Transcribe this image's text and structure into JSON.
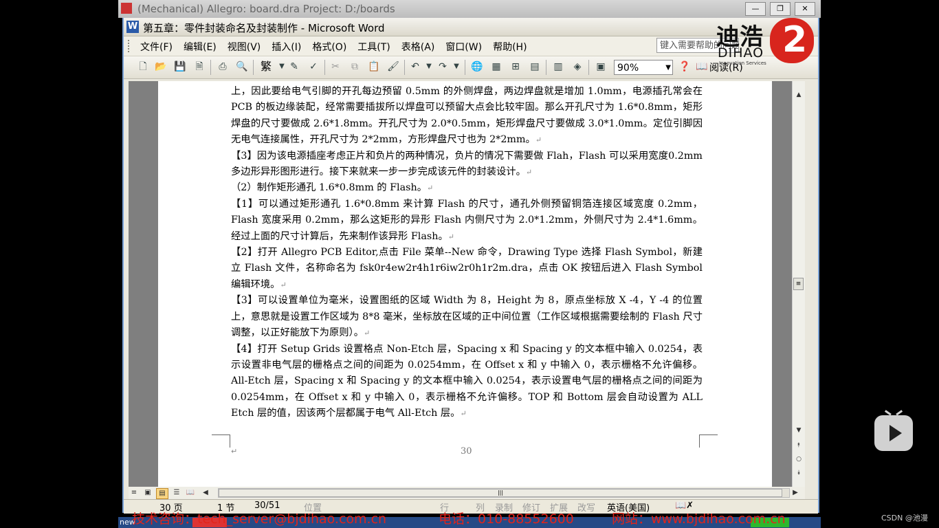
{
  "background_window": {
    "title": "(Mechanical) Allegro: board.dra  Project: D:/boards"
  },
  "window": {
    "title": "第五章：零件封装命名及封装制作 - Microsoft Word",
    "app_icon": "W"
  },
  "menu": {
    "items": [
      "文件(F)",
      "编辑(E)",
      "视图(V)",
      "插入(I)",
      "格式(O)",
      "工具(T)",
      "表格(A)",
      "窗口(W)",
      "帮助(H)"
    ],
    "help_placeholder": "键入需要帮助的问题"
  },
  "toolbar": {
    "zoom": "90%",
    "fanti": "繁",
    "read": "阅读(R)",
    "icons": [
      "new-icon",
      "open-icon",
      "save-icon",
      "permission-icon",
      "print-icon",
      "preview-icon",
      "fanti-icon",
      "research-icon",
      "spell-icon",
      "cut-icon",
      "copy-icon",
      "paste-icon",
      "format-painter-icon",
      "undo-icon",
      "redo-icon",
      "hyperlink-icon",
      "tables-borders-icon",
      "insert-table-icon",
      "insert-excel-icon",
      "columns-icon",
      "drawing-icon",
      "docmap-icon",
      "help-icon",
      "read-icon"
    ]
  },
  "logo": {
    "cn": "迪浩",
    "en": "DIHAO",
    "sub": "Innovation Services",
    "mark": "2"
  },
  "document": {
    "paragraphs": [
      "上，因此要给电气引脚的开孔每边预留 0.5mm 的外侧焊盘，两边焊盘就是增加 1.0mm，电源插孔常会在PCB 的板边缘装配，经常需要插拔所以焊盘可以预留大点会比较牢固。那么开孔尺寸为 1.6*0.8mm，矩形焊盘的尺寸要做成 2.6*1.8mm。开孔尺寸为 2.0*0.5mm，矩形焊盘尺寸要做成 3.0*1.0mm。定位引脚因无电气连接属性，开孔尺寸为 2*2mm，方形焊盘尺寸也为 2*2mm。",
      "【3】因为该电源插座考虑正片和负片的两种情况，负片的情况下需要做 Flah，Flash 可以采用宽度0.2mm 多边形异形图形进行。接下来就来一步一步完成该元件的封装设计。",
      "（2）制作矩形通孔 1.6*0.8mm 的 Flash。",
      "【1】可以通过矩形通孔 1.6*0.8mm 来计算 Flash 的尺寸，通孔外侧预留铜箔连接区域宽度 0.2mm，Flash 宽度采用 0.2mm，那么这矩形的异形 Flash 内侧尺寸为 2.0*1.2mm，外侧尺寸为 2.4*1.6mm。经过上面的尺寸计算后，先来制作该异形 Flash。",
      "【2】打开 Allegro PCB Editor,点击 File 菜单--New 命令，Drawing Type 选择 Flash Symbol，新建立 Flash 文件，名称命名为 fsk0r4ew2r4h1r6iw2r0h1r2m.dra，点击 OK 按钮后进入 Flash Symbol 编辑环境。",
      "【3】可以设置单位为毫米，设置图纸的区域 Width 为 8，Height 为 8，原点坐标放 X -4，Y -4 的位置上，意思就是设置工作区域为 8*8 毫米，坐标放在区域的正中间位置（工作区域根据需要绘制的 Flash 尺寸调整，以正好能放下为原则）。",
      "【4】打开 Setup Grids 设置格点 Non-Etch 层，Spacing x 和 Spacing y 的文本框中输入 0.0254，表示设置非电气层的栅格点之间的间距为 0.0254mm，在 Offset x 和 y 中输入 0，表示栅格不允许偏移。All-Etch 层，Spacing x 和 Spacing y 的文本框中输入 0.0254，表示设置电气层的栅格点之间的间距为 0.0254mm，在 Offset x 和 y 中输入 0，表示栅格不允许偏移。TOP 和 Bottom 层会自动设置为 ALL Etch 层的值，因该两个层都属于电气 All-Etch 层。"
    ],
    "paragraph_mark": "↵",
    "page_number": "30"
  },
  "statusbar": {
    "page": "30 页",
    "section": "1 节",
    "pages": "30/51",
    "position": "位置",
    "line": "行",
    "col": "列",
    "rec": "录制",
    "trk": "修订",
    "ext": "扩展",
    "ovr": "改写",
    "language": "英语(美国)"
  },
  "overlay": {
    "contact_email": "技术咨询：tech_server@bjdihao.com.cn",
    "contact_phone": "电话：010-88552600",
    "contact_web": "网站：www.bjdihao.com.cn",
    "watermark": "CSDN @池漫"
  }
}
